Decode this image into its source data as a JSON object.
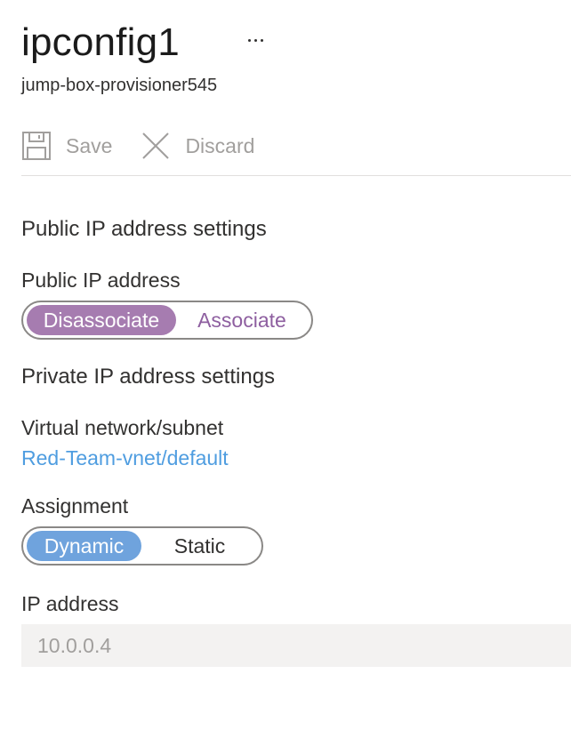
{
  "header": {
    "title": "ipconfig1",
    "more_label": "...",
    "subtitle": "jump-box-provisioner545"
  },
  "toolbar": {
    "save_label": "Save",
    "save_icon": "save-icon",
    "discard_label": "Discard",
    "discard_icon": "close-icon"
  },
  "public_ip_section": {
    "heading": "Public IP address settings",
    "field_label": "Public IP address",
    "options": [
      "Disassociate",
      "Associate"
    ],
    "selected": "Disassociate"
  },
  "private_ip_section": {
    "heading": "Private IP address settings",
    "vnet_label": "Virtual network/subnet",
    "vnet_link": "Red-Team-vnet/default",
    "assignment_label": "Assignment",
    "assignment_options": [
      "Dynamic",
      "Static"
    ],
    "assignment_selected": "Dynamic",
    "ip_label": "IP address",
    "ip_value": "10.0.0.4"
  },
  "colors": {
    "public_toggle_accent": "#a67cb0",
    "assignment_toggle_accent": "#6fa3dd",
    "link": "#4f9de0",
    "disabled_text": "#a19f9d"
  }
}
